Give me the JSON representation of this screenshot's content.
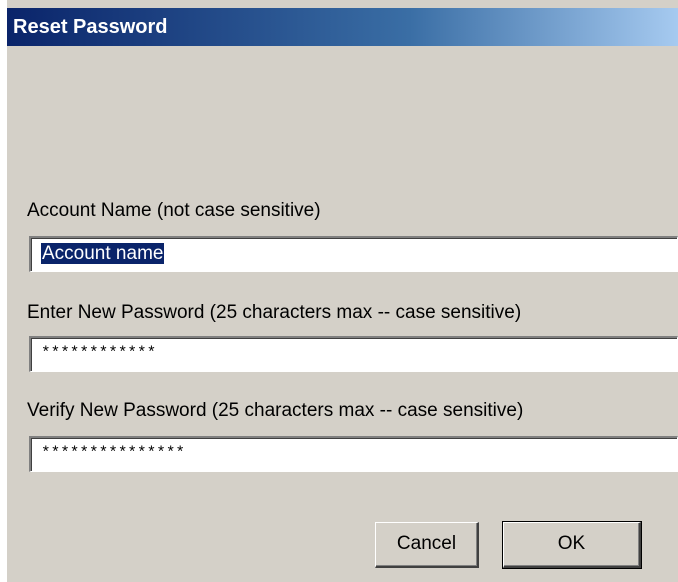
{
  "dialog": {
    "title": "Reset Password"
  },
  "account": {
    "label": "Account Name (not case sensitive)",
    "value": "Account name"
  },
  "new_password": {
    "label": "Enter New Password (25 characters max -- case sensitive)",
    "value": "************"
  },
  "verify_password": {
    "label": "Verify New Password (25 characters max -- case sensitive)",
    "value": "***************"
  },
  "buttons": {
    "cancel_label": "Cancel",
    "ok_label": "OK"
  },
  "colors": {
    "titlebar_start": "#0a246a",
    "titlebar_end": "#a6caf0",
    "dialog_background": "#d4d0c8",
    "selection": "#0a246a"
  }
}
